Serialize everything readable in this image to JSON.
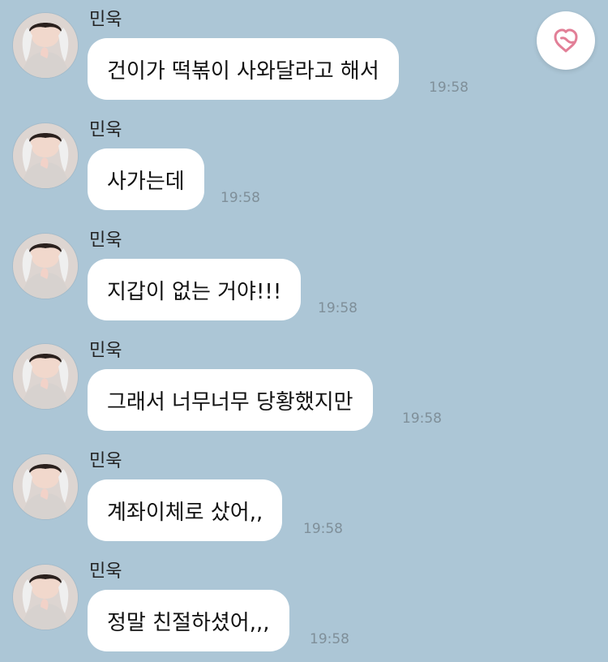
{
  "messages": [
    {
      "sender": "민욱",
      "text": "건이가 떡볶이 사와달라고 해서",
      "time": "19:58"
    },
    {
      "sender": "민욱",
      "text": "사가는데",
      "time": "19:58"
    },
    {
      "sender": "민욱",
      "text": "지갑이 없는 거야!!!",
      "time": "19:58"
    },
    {
      "sender": "민욱",
      "text": "그래서 너무너무 당황했지만",
      "time": "19:58"
    },
    {
      "sender": "민욱",
      "text": "계좌이체로 샀어,,",
      "time": "19:58"
    },
    {
      "sender": "민욱",
      "text": "정말 친절하셨어,,,",
      "time": "19:58"
    }
  ],
  "colors": {
    "background": "#acc6d6",
    "bubble": "#ffffff",
    "heart": "#e27f97",
    "time": "#7f8f99"
  },
  "heart_button": {
    "icon": "heart-icon"
  }
}
